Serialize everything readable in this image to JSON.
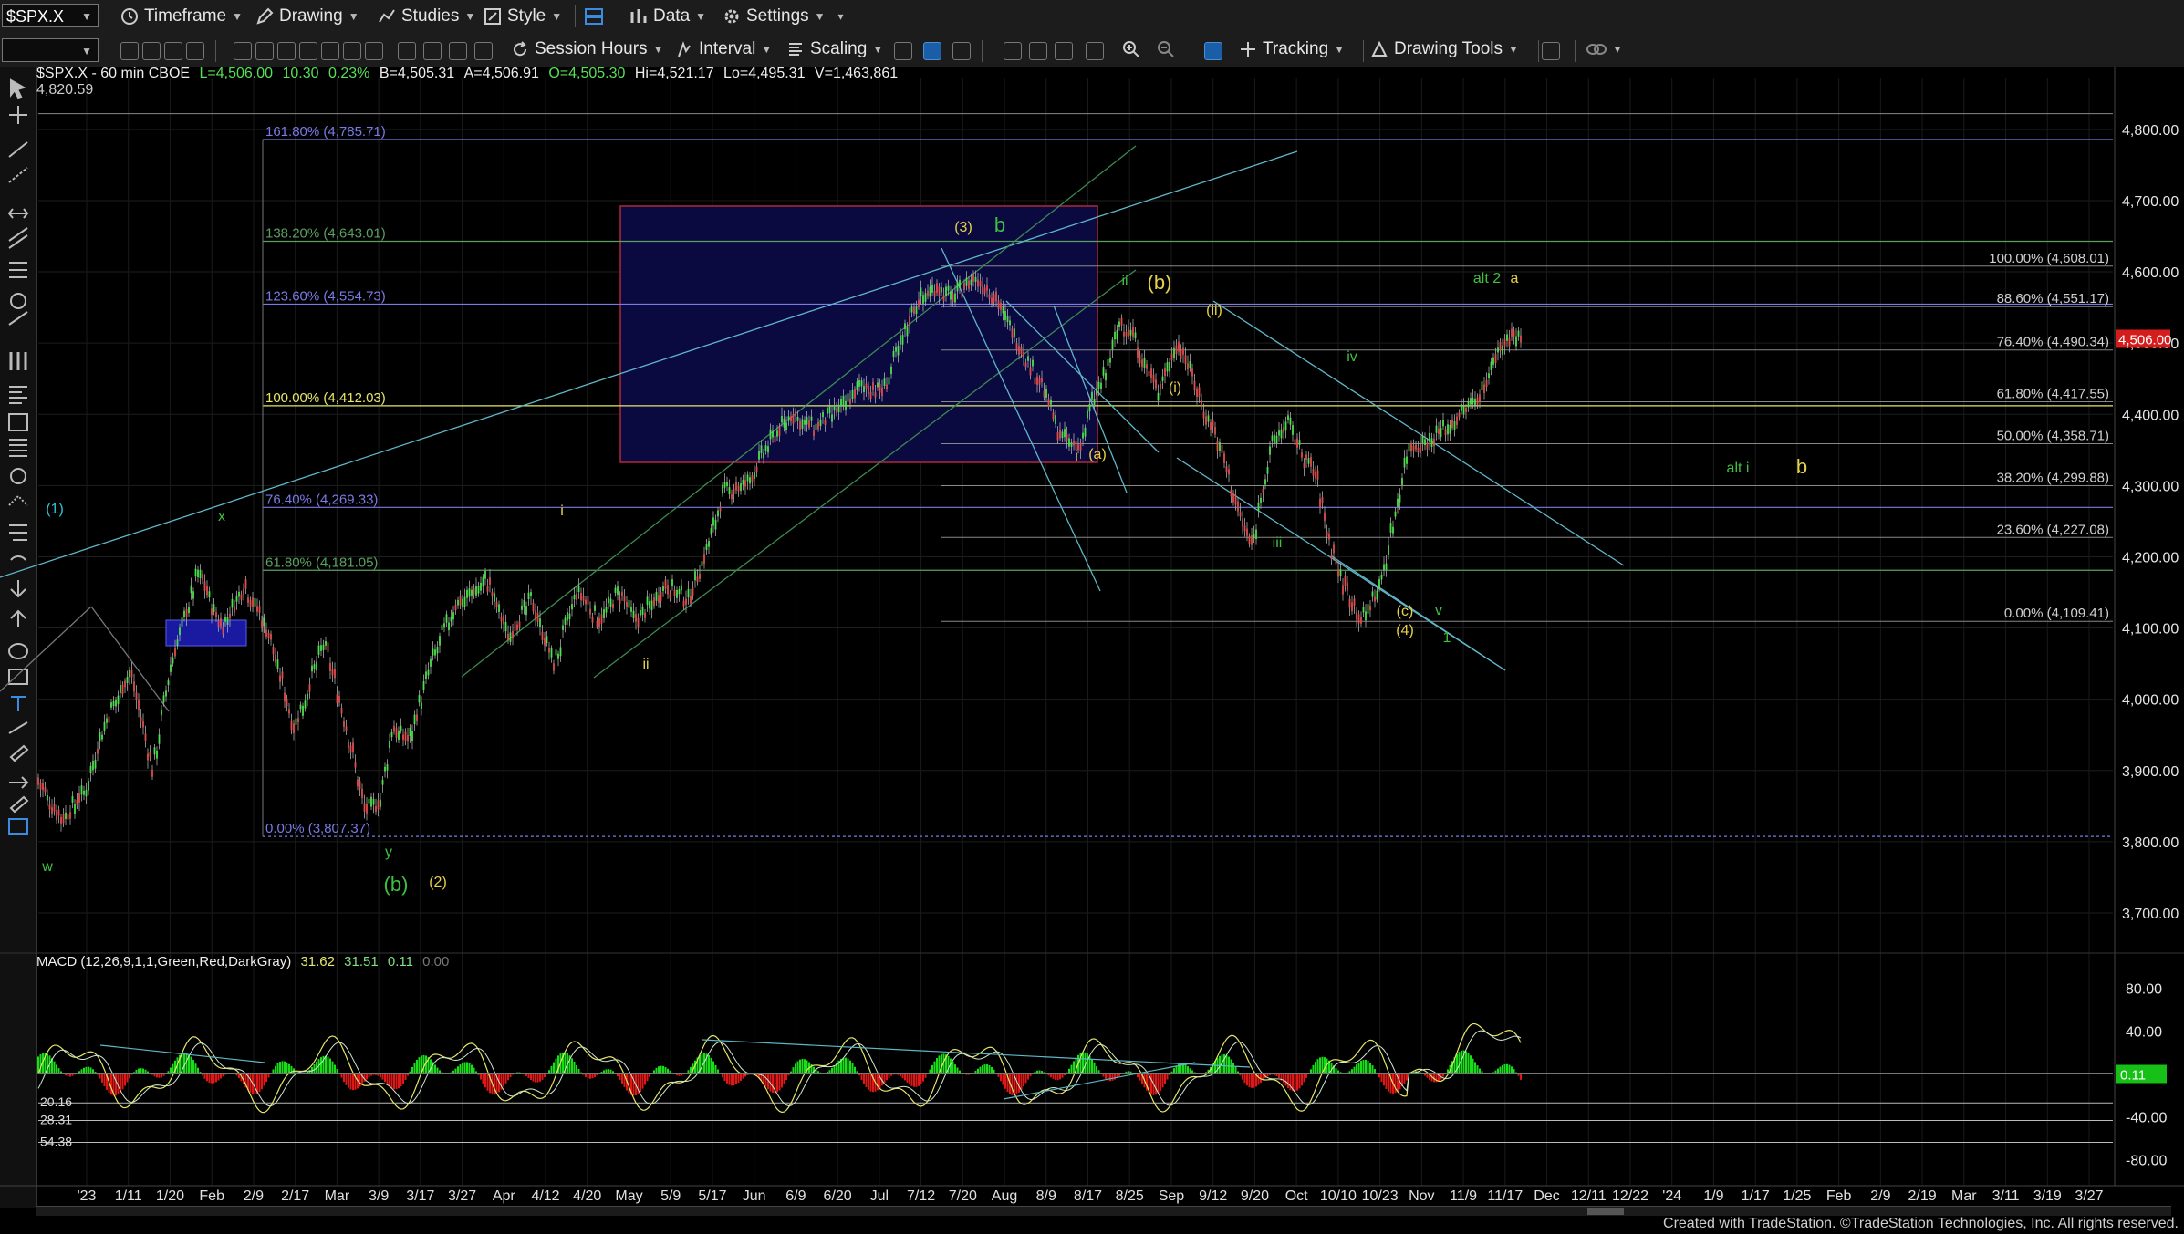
{
  "toolbar": {
    "symbol": "$SPX.X",
    "timeframe": "Timeframe",
    "drawing": "Drawing",
    "studies": "Studies",
    "style": "Style",
    "data": "Data",
    "settings": "Settings",
    "session_hours": "Session Hours",
    "interval": "Interval",
    "scaling": "Scaling",
    "tracking": "Tracking",
    "drawing_tools": "Drawing Tools"
  },
  "header": {
    "line1_prefix": "$SPX.X - 60 min  CBOE",
    "last": "L=4,506.00",
    "chg": "10.30",
    "pct": "0.23%",
    "bid": "B=4,505.31",
    "ask": "A=4,506.91",
    "open": "O=4,505.30",
    "high": "Hi=4,521.17",
    "low": "Lo=4,495.31",
    "volume": "V=1,463,861",
    "line2": "4,820.59"
  },
  "macd": {
    "label": "MACD (12,26,9,1,1,Green,Red,DarkGray)",
    "v1": "31.62",
    "v2": "31.51",
    "v3": "0.11",
    "v4": "0.00",
    "axis_labels": [
      "80.00",
      "40.00",
      "-40.00",
      "-80.00"
    ],
    "current_tag": "0.11",
    "left_labels": [
      "20.16",
      "28.31",
      "54.38"
    ]
  },
  "chart_data": {
    "type": "candlestick",
    "price_axis": [
      "4,800.00",
      "4,700.00",
      "4,600.00",
      "4,500.00",
      "4,400.00",
      "4,300.00",
      "4,200.00",
      "4,100.00",
      "4,000.00",
      "3,900.00",
      "3,800.00",
      "3,700.00"
    ],
    "ylim": [
      3650,
      4860
    ],
    "current_price_tag": "4,506.00",
    "x_ticks": [
      "'23",
      "1/11",
      "1/20",
      "Feb",
      "2/9",
      "2/17",
      "Mar",
      "3/9",
      "3/17",
      "3/27",
      "Apr",
      "4/12",
      "4/20",
      "May",
      "5/9",
      "5/17",
      "Jun",
      "6/9",
      "6/20",
      "Jul",
      "7/12",
      "7/20",
      "Aug",
      "8/9",
      "8/17",
      "8/25",
      "Sep",
      "9/12",
      "9/20",
      "Oct",
      "10/10",
      "10/23",
      "Nov",
      "11/9",
      "11/17",
      "Dec",
      "12/11",
      "12/22",
      "'24",
      "1/9",
      "1/17",
      "1/25",
      "Feb",
      "2/9",
      "2/19",
      "Mar",
      "3/11",
      "3/19",
      "3/27"
    ],
    "price_path_x": [
      0,
      10,
      20,
      28,
      40,
      50,
      58,
      70,
      80,
      90,
      100,
      112,
      125,
      135,
      143,
      150,
      155,
      162,
      172,
      182,
      196,
      206,
      216,
      226,
      236,
      246,
      254,
      262,
      275,
      285,
      292,
      300,
      310,
      320,
      330,
      340,
      352,
      360,
      370,
      378,
      385,
      393,
      400,
      410,
      418,
      425,
      433,
      440,
      448,
      456,
      462,
      468,
      474,
      480,
      485,
      490,
      495,
      500,
      505,
      510,
      515,
      520,
      527,
      532,
      536,
      542,
      548,
      553,
      560,
      566,
      572,
      580,
      588,
      594,
      600,
      606,
      612,
      620,
      628,
      634,
      640,
      645,
      650
    ],
    "price_path_y": [
      3880,
      3830,
      3870,
      3960,
      4040,
      3900,
      4050,
      4180,
      4100,
      4160,
      4100,
      3960,
      4080,
      3960,
      3840,
      3860,
      3960,
      3940,
      4050,
      4130,
      4170,
      4090,
      4140,
      4050,
      4150,
      4110,
      4150,
      4110,
      4160,
      4140,
      4200,
      4290,
      4300,
      4360,
      4400,
      4380,
      4410,
      4440,
      4430,
      4500,
      4560,
      4580,
      4565,
      4590,
      4570,
      4530,
      4480,
      4440,
      4370,
      4350,
      4420,
      4460,
      4530,
      4510,
      4470,
      4430,
      4470,
      4500,
      4460,
      4410,
      4380,
      4330,
      4250,
      4210,
      4290,
      4370,
      4390,
      4350,
      4310,
      4220,
      4160,
      4110,
      4160,
      4250,
      4350,
      4360,
      4370,
      4390,
      4415,
      4440,
      4490,
      4510,
      4506
    ],
    "fib_left": [
      "161.80% (4,785.71)",
      "138.20% (4,643.01)",
      "123.60% (4,554.73)",
      "100.00% (4,412.03)",
      "76.40% (4,269.33)",
      "61.80% (4,181.05)",
      "0.00% (3,807.37)"
    ],
    "fib_left_values": [
      4785.71,
      4643.01,
      4554.73,
      4412.03,
      4269.33,
      4181.05,
      3807.37
    ],
    "fib_right": [
      "100.00% (4,608.01)",
      "88.60% (4,551.17)",
      "76.40% (4,490.34)",
      "61.80% (4,417.55)",
      "50.00% (4,358.71)",
      "38.20% (4,299.88)",
      "23.60% (4,227.08)",
      "0.00% (4,109.41)"
    ],
    "fib_right_values": [
      4608.01,
      4551.17,
      4490.34,
      4417.55,
      4358.71,
      4299.88,
      4227.08,
      4109.41
    ],
    "wave_labels": [
      "(1)",
      "w",
      "x",
      "y",
      "(b)",
      "(2)",
      "i",
      "ii",
      "(3)",
      "b",
      "i",
      "(a)",
      "ii",
      "(b)",
      "(i)",
      "(ii)",
      "iii",
      "iv",
      "(c)",
      "(4)",
      "v",
      "1",
      "alt 2",
      "a",
      "alt i",
      "b"
    ],
    "colors": {
      "fib_blue": "#7a7ae6",
      "fib_green": "#5aa060",
      "fib_yellow": "#e6e66a",
      "wave_green": "#3fc13f",
      "wave_yellow": "#e6d24a",
      "wave_cyan": "#35c0d8",
      "trend_cyan": "#5fb7c8",
      "box_red": "#b0283a",
      "box_fill": "#0a0a40",
      "macd_up": "#17e017",
      "macd_down": "#e01717",
      "price_tag": "#d41c1c"
    }
  },
  "footer": {
    "credit": "Created with TradeStation. ©TradeStation Technologies, Inc. All rights reserved."
  }
}
